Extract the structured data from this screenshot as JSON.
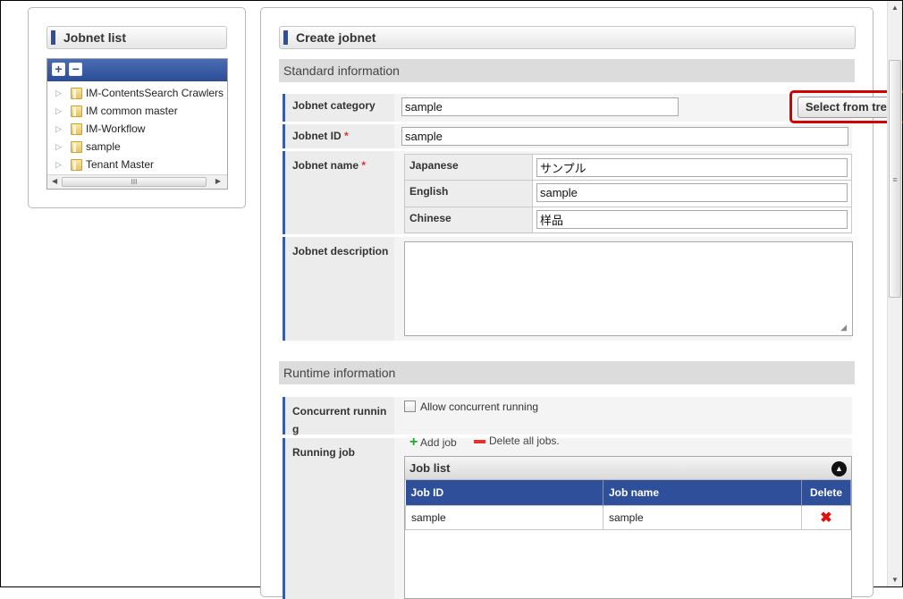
{
  "left": {
    "title": "Jobnet list",
    "toolbar": {
      "expand": "+",
      "collapse": "−"
    },
    "tree": [
      {
        "label": "IM-ContentsSearch Crawlers"
      },
      {
        "label": "IM common master"
      },
      {
        "label": "IM-Workflow"
      },
      {
        "label": "sample"
      },
      {
        "label": "Tenant Master"
      }
    ],
    "hscroll_grip": "III"
  },
  "main": {
    "title": "Create jobnet",
    "standard": {
      "heading": "Standard information",
      "category": {
        "label": "Jobnet category",
        "value": "sample",
        "button": "Select from tree"
      },
      "jobnet_id": {
        "label": "Jobnet ID",
        "required": "*",
        "value": "sample"
      },
      "jobnet_name": {
        "label": "Jobnet name",
        "required": "*",
        "langs": [
          {
            "lang": "Japanese",
            "value": "サンプル"
          },
          {
            "lang": "English",
            "value": "sample"
          },
          {
            "lang": "Chinese",
            "value": "样品"
          }
        ]
      },
      "description": {
        "label": "Jobnet description",
        "value": ""
      }
    },
    "runtime": {
      "heading": "Runtime information",
      "concurrent": {
        "label_1": "Concurrent runnin",
        "label_2": "g",
        "checkbox_label": "Allow concurrent running",
        "checked": false
      },
      "running_job": {
        "label": "Running job",
        "add": "Add job",
        "delete_all": "Delete all jobs.",
        "job_list_title": "Job list",
        "columns": [
          "Job ID",
          "Job name",
          "Delete"
        ],
        "rows": [
          {
            "job_id": "sample",
            "job_name": "sample",
            "delete": "✖"
          }
        ]
      }
    }
  },
  "colors": {
    "accent": "#2f4f9a",
    "highlight": "#d40000",
    "required": "#e03030"
  },
  "scrollbar": {
    "grip": "≡"
  }
}
